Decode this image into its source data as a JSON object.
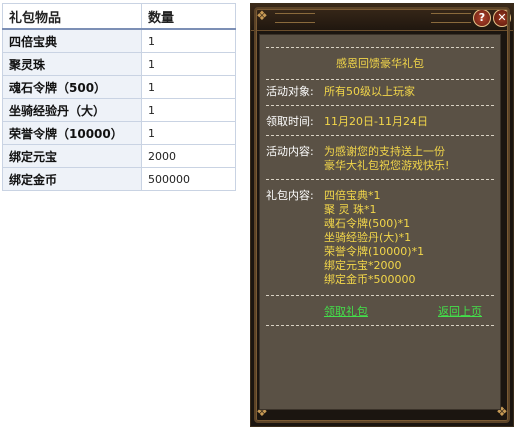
{
  "table": {
    "header": {
      "item": "礼包物品",
      "qty": "数量"
    },
    "rows": [
      {
        "item": "四倍宝典",
        "qty": "1"
      },
      {
        "item": "聚灵珠",
        "qty": "1"
      },
      {
        "item": "魂石令牌（500）",
        "qty": "1"
      },
      {
        "item": "坐骑经验丹（大）",
        "qty": "1"
      },
      {
        "item": "荣誉令牌（10000）",
        "qty": "1"
      },
      {
        "item": "绑定元宝",
        "qty": "2000"
      },
      {
        "item": "绑定金币",
        "qty": "500000"
      }
    ]
  },
  "panel": {
    "help_icon": "?",
    "close_icon": "✕",
    "title": "感恩回馈豪华礼包",
    "target_label": "活动对象:",
    "target_value": "所有50级以上玩家",
    "time_label": "领取时间:",
    "time_value": "11月20日-11月24日",
    "content_label": "活动内容:",
    "content_lines": [
      "为感谢您的支持送上一份",
      "豪华大礼包祝您游戏快乐!"
    ],
    "gift_label": "礼包内容:",
    "gift_lines": [
      "四倍宝典*1",
      "聚 灵 珠*1",
      "魂石令牌(500)*1",
      "坐骑经验丹(大)*1",
      "荣誉令牌(10000)*1",
      "绑定元宝*2000",
      "绑定金币*500000"
    ],
    "claim_link": "领取礼包",
    "back_link": "返回上页"
  },
  "colors": {
    "accent_yellow": "#f2d64a",
    "link_green": "#43e04a",
    "panel_bg": "#5a5145"
  }
}
